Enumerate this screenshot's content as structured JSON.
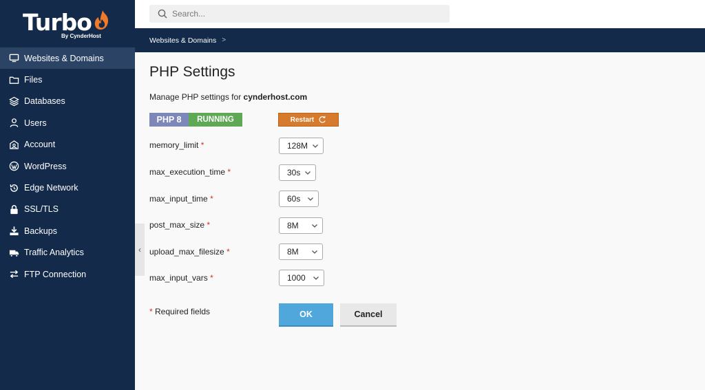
{
  "brand": {
    "name": "Turbo",
    "sub": "By CynderHost",
    "flame_color": "#ef7b2a"
  },
  "sidebar": {
    "items": [
      {
        "label": "Websites & Domains",
        "icon": "monitor-icon",
        "active": true
      },
      {
        "label": "Files",
        "icon": "folder-icon"
      },
      {
        "label": "Databases",
        "icon": "layers-icon"
      },
      {
        "label": "Users",
        "icon": "user-icon"
      },
      {
        "label": "Account",
        "icon": "account-icon"
      },
      {
        "label": "WordPress",
        "icon": "wordpress-icon"
      },
      {
        "label": "Edge Network",
        "icon": "refresh-icon"
      },
      {
        "label": "SSL/TLS",
        "icon": "lock-icon"
      },
      {
        "label": "Backups",
        "icon": "download-icon"
      },
      {
        "label": "Traffic Analytics",
        "icon": "truck-icon"
      },
      {
        "label": "FTP Connection",
        "icon": "transfer-icon"
      }
    ]
  },
  "search": {
    "placeholder": "Search..."
  },
  "breadcrumb": {
    "item": "Websites & Domains",
    "separator": ">"
  },
  "page": {
    "title": "PHP Settings",
    "subtitle_prefix": "Manage PHP settings for ",
    "domain": "cynderhost.com"
  },
  "status": {
    "php_label": "PHP 8",
    "state": "RUNNING",
    "restart_label": "Restart"
  },
  "settings": [
    {
      "label": "memory_limit",
      "value": "128M"
    },
    {
      "label": "max_execution_time",
      "value": "30s"
    },
    {
      "label": "max_input_time",
      "value": "60s"
    },
    {
      "label": "post_max_size",
      "value": "8M"
    },
    {
      "label": "upload_max_filesize",
      "value": "8M"
    },
    {
      "label": "max_input_vars",
      "value": "1000"
    }
  ],
  "form": {
    "required_marker": "*",
    "required_note": "Required fields",
    "ok_label": "OK",
    "cancel_label": "Cancel"
  },
  "colors": {
    "sidebar_bg": "#132a4a",
    "accent_orange": "#d67a2e",
    "php_badge": "#7d88b8",
    "running_badge": "#5ea856",
    "ok_button": "#4fa7dc"
  }
}
